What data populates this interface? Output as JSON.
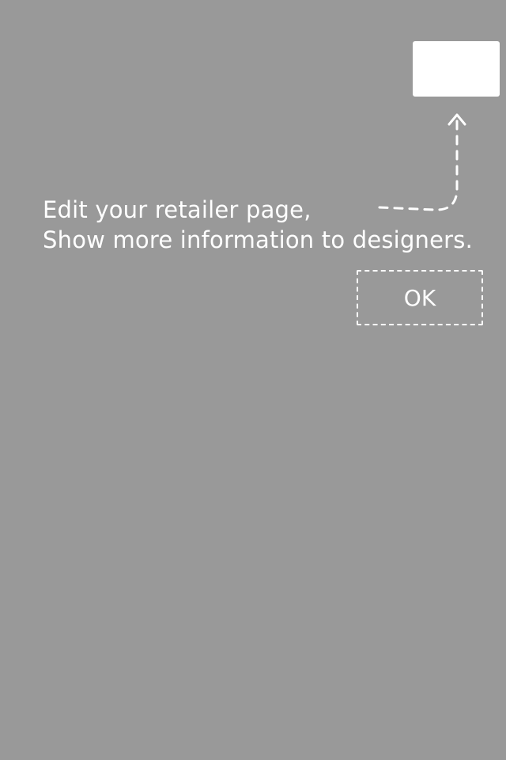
{
  "guide": {
    "message_line1": "Edit your retailer page,",
    "message_line2": "Show more information to designers.",
    "ok_label": "OK"
  },
  "colors": {
    "overlay": "#999999",
    "text": "#ffffff",
    "highlight": "#ffffff"
  }
}
